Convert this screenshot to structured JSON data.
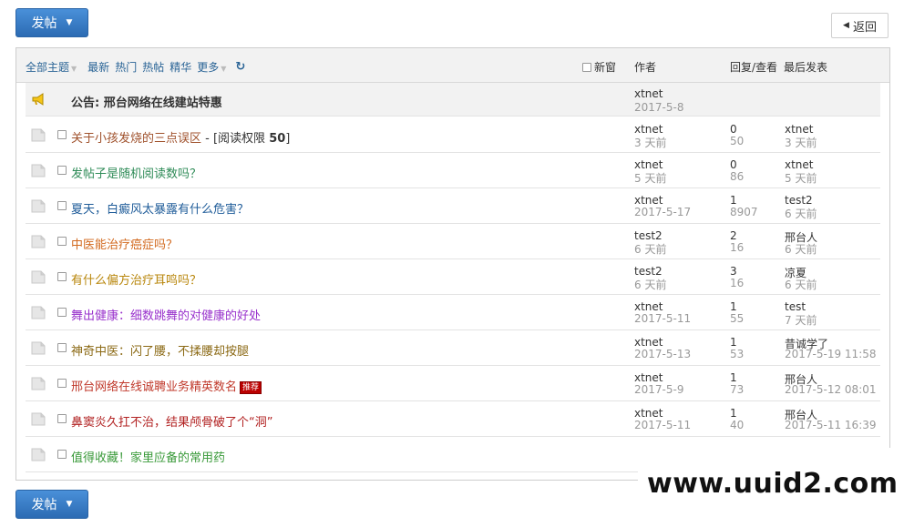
{
  "toolbar": {
    "post_label": "发帖",
    "back_label": "返回"
  },
  "filters": {
    "all_topics": "全部主题",
    "items": [
      "最新",
      "热门",
      "热帖",
      "精华"
    ],
    "more": "更多"
  },
  "header": {
    "new_window": "新窗",
    "author": "作者",
    "reply_view": "回复/查看",
    "last_post": "最后发表"
  },
  "announcement": {
    "title": "公告: 邢台网络在线建站特惠",
    "author": "xtnet",
    "date": "2017-5-8"
  },
  "threads": [
    {
      "title": "关于小孩发烧的三点误区",
      "perm_prefix": " - [阅读权限 ",
      "perm_value": "50",
      "perm_suffix": "]",
      "color": "#a0522d",
      "author": "xtnet",
      "date": "3 天前",
      "replies": "0",
      "views": "50",
      "last_user": "xtnet",
      "last_date": "3 天前"
    },
    {
      "title": "发帖子是随机阅读数吗？",
      "color": "#2e8b57",
      "author": "xtnet",
      "date": "5 天前",
      "replies": "0",
      "views": "86",
      "last_user": "xtnet",
      "last_date": "5 天前"
    },
    {
      "title": "夏天，白癜风太暴露有什么危害？",
      "color": "#1f5c99",
      "author": "xtnet",
      "date": "2017-5-17",
      "replies": "1",
      "views": "8907",
      "last_user": "test2",
      "last_date": "6 天前"
    },
    {
      "title": "中医能治疗癌症吗？",
      "color": "#d2691e",
      "author": "test2",
      "date": "6 天前",
      "replies": "2",
      "views": "16",
      "last_user": "邢台人",
      "last_date": "6 天前"
    },
    {
      "title": "有什么偏方治疗耳鸣吗？",
      "color": "#b8860b",
      "author": "test2",
      "date": "6 天前",
      "replies": "3",
      "views": "16",
      "last_user": "凉夏",
      "last_date": "6 天前"
    },
    {
      "title": "舞出健康：细数跳舞的对健康的好处",
      "color": "#9932cc",
      "author": "xtnet",
      "date": "2017-5-11",
      "replies": "1",
      "views": "55",
      "last_user": "test",
      "last_date": "7 天前"
    },
    {
      "title": "神奇中医：闪了腰，不揉腰却按腿",
      "color": "#8b6914",
      "author": "xtnet",
      "date": "2017-5-13",
      "replies": "1",
      "views": "53",
      "last_user": "昔诚学了",
      "last_date": "2017-5-19 11:58"
    },
    {
      "title": "邢台网络在线诚聘业务精英数名",
      "badge": "推荐",
      "color": "#c0392b",
      "author": "xtnet",
      "date": "2017-5-9",
      "replies": "1",
      "views": "73",
      "last_user": "邢台人",
      "last_date": "2017-5-12 08:01"
    },
    {
      "title": "鼻窦炎久扛不治，结果颅骨破了个“洞”",
      "color": "#b22222",
      "author": "xtnet",
      "date": "2017-5-11",
      "replies": "1",
      "views": "40",
      "last_user": "邢台人",
      "last_date": "2017-5-11 16:39"
    },
    {
      "title": "值得收藏！家里应备的常用药",
      "color": "#3a9a3a",
      "author": "",
      "date": "",
      "replies": "",
      "views": "",
      "last_user": "",
      "last_date": ""
    }
  ],
  "watermark": "www.uuid2.com"
}
